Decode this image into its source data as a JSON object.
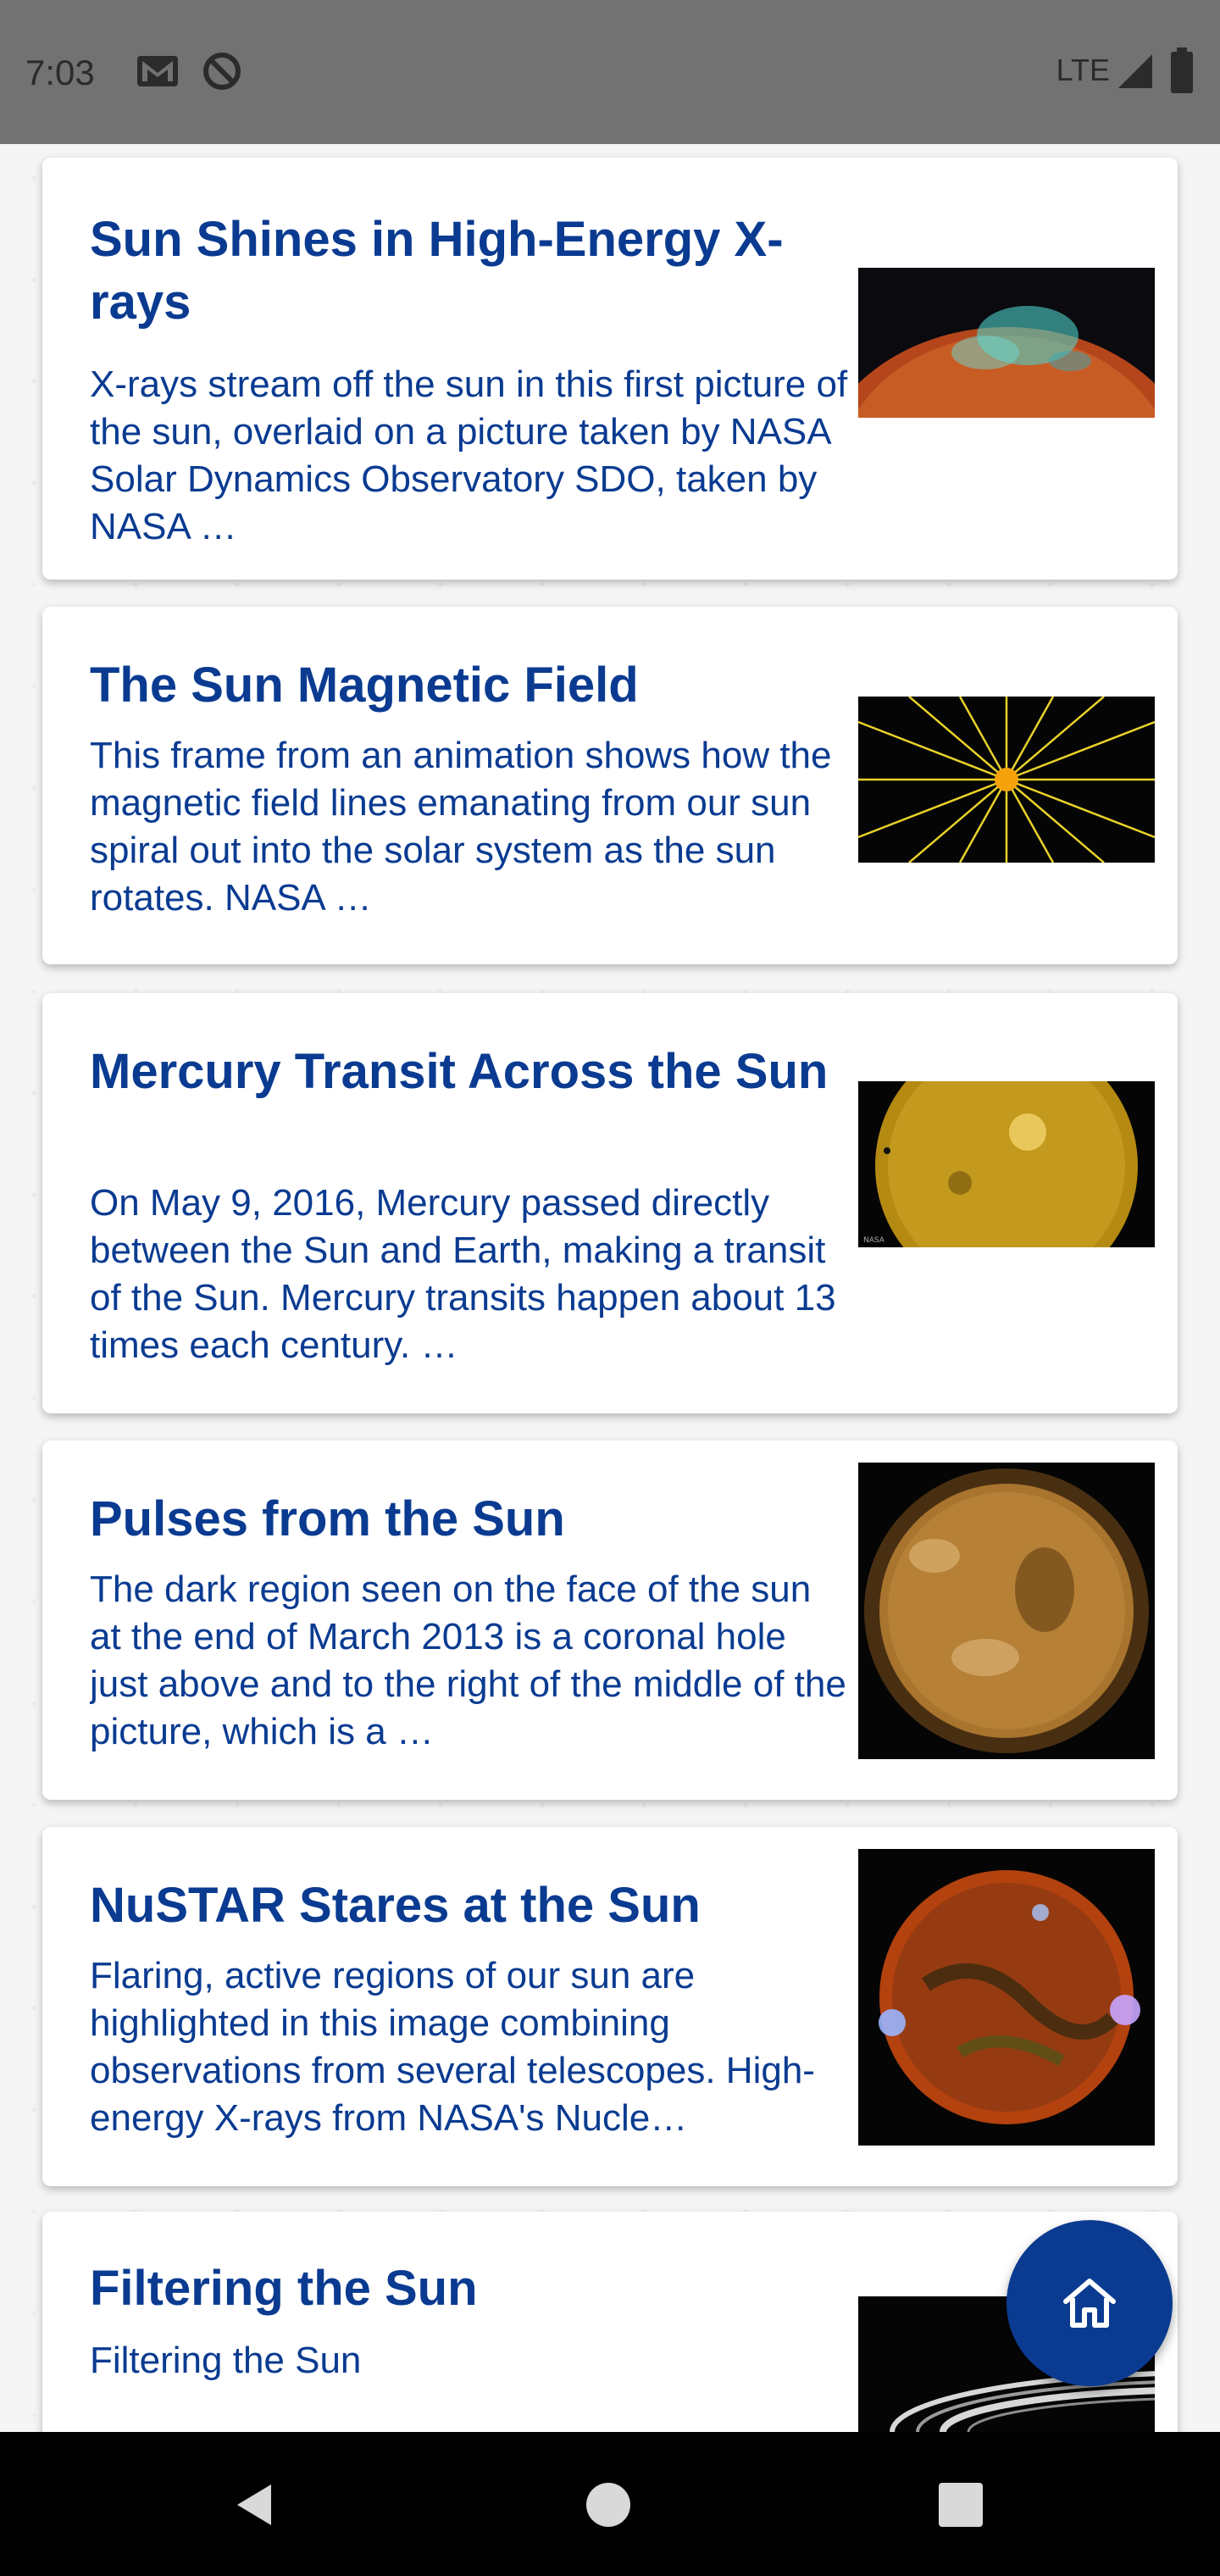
{
  "status_bar": {
    "time": "7:03",
    "network": "LTE"
  },
  "articles": [
    {
      "title": "Sun Shines in High-Energy X-rays",
      "description": "X-rays stream off the sun in this first picture of the sun, overlaid on a picture taken by NASA Solar Dynamics Observatory SDO, taken by NASA …",
      "image_icon": "xray-sun-image"
    },
    {
      "title": "The Sun Magnetic Field",
      "description": "This frame from an animation shows how the magnetic field lines emanating from our sun spiral out into the solar system as the sun rotates. NASA …",
      "image_icon": "magnetic-field-image"
    },
    {
      "title": "Mercury Transit Across the Sun",
      "description": "On May 9, 2016, Mercury passed directly between the Sun and Earth, making a transit of the Sun. Mercury transits happen about 13 times each century. …",
      "image_icon": "mercury-transit-image"
    },
    {
      "title": "Pulses from the Sun",
      "description": "The dark region seen on the face of the sun at the end of March 2013 is a coronal hole just above and to the right of the middle of the picture, which is a …",
      "image_icon": "sun-pulses-image"
    },
    {
      "title": "NuSTAR Stares at the Sun",
      "description": "Flaring, active regions of our sun are highlighted in this image combining observations from several telescopes. High-energy X-rays from NASA's Nucle…",
      "image_icon": "nustar-sun-image"
    },
    {
      "title": "Filtering the Sun",
      "description": "Filtering the Sun",
      "image_icon": "saturn-rings-image"
    }
  ],
  "fab": {
    "icon": "home-icon"
  },
  "nav_bar": {
    "back_icon": "back-icon",
    "home_icon": "home-circle-icon",
    "recents_icon": "recents-icon"
  },
  "colors": {
    "accent": "#0a3b91",
    "status_bar": "#727272",
    "nav_bar": "#000000"
  }
}
